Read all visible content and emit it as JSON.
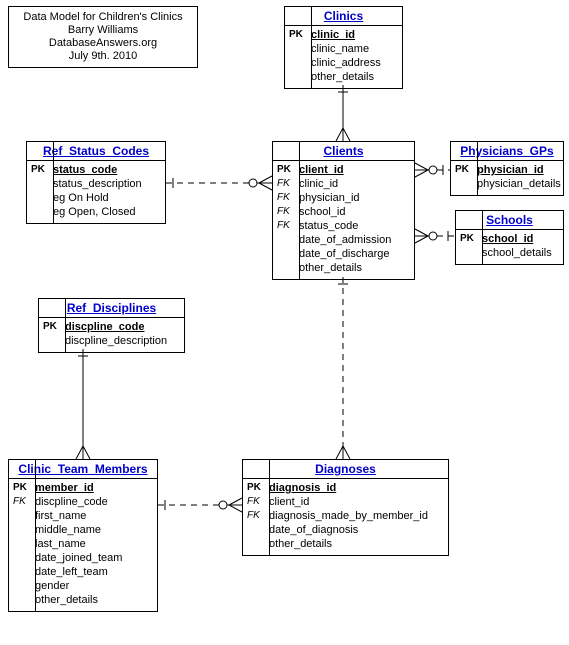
{
  "title": {
    "line1": "Data Model for Children's Clinics",
    "line2": "Barry Williams",
    "line3": "DatabaseAnswers.org",
    "line4": "July 9th. 2010"
  },
  "entities": {
    "clinics": {
      "name": "Clinics",
      "attrs": [
        {
          "key": "PK",
          "col": "clinic_id",
          "pk": true
        },
        {
          "key": "",
          "col": "clinic_name"
        },
        {
          "key": "",
          "col": "clinic_address"
        },
        {
          "key": "",
          "col": "other_details"
        }
      ]
    },
    "clients": {
      "name": "Clients",
      "attrs": [
        {
          "key": "PK",
          "col": "client_id",
          "pk": true
        },
        {
          "key": "FK",
          "col": "clinic_id",
          "fk": true
        },
        {
          "key": "FK",
          "col": "physician_id",
          "fk": true
        },
        {
          "key": "FK",
          "col": "school_id",
          "fk": true
        },
        {
          "key": "FK",
          "col": "status_code",
          "fk": true
        },
        {
          "key": "",
          "col": "date_of_admission"
        },
        {
          "key": "",
          "col": "date_of_discharge"
        },
        {
          "key": "",
          "col": "other_details"
        }
      ]
    },
    "ref_status_codes": {
      "name": "Ref_Status_Codes",
      "attrs": [
        {
          "key": "PK",
          "col": "status_code",
          "pk": true
        },
        {
          "key": "",
          "col": "status_description"
        },
        {
          "key": "",
          "col": "eg On Hold"
        },
        {
          "key": "",
          "col": "eg Open, Closed"
        }
      ]
    },
    "physicians_gps": {
      "name": "Physicians_GPs",
      "attrs": [
        {
          "key": "PK",
          "col": "physician_id",
          "pk": true
        },
        {
          "key": "",
          "col": "physician_details"
        }
      ]
    },
    "schools": {
      "name": "Schools",
      "attrs": [
        {
          "key": "PK",
          "col": "school_id",
          "pk": true
        },
        {
          "key": "",
          "col": "school_details"
        }
      ]
    },
    "ref_disciplines": {
      "name": "Ref_Disciplines",
      "attrs": [
        {
          "key": "PK",
          "col": "discpline_code",
          "pk": true
        },
        {
          "key": "",
          "col": "discpline_description"
        }
      ]
    },
    "clinic_team_members": {
      "name": "Clinic_Team_Members",
      "attrs": [
        {
          "key": "PK",
          "col": "member_id",
          "pk": true
        },
        {
          "key": "FK",
          "col": "discpline_code",
          "fk": true
        },
        {
          "key": "",
          "col": "first_name"
        },
        {
          "key": "",
          "col": "middle_name"
        },
        {
          "key": "",
          "col": "last_name"
        },
        {
          "key": "",
          "col": "date_joined_team"
        },
        {
          "key": "",
          "col": "date_left_team"
        },
        {
          "key": "",
          "col": "gender"
        },
        {
          "key": "",
          "col": "other_details"
        }
      ]
    },
    "diagnoses": {
      "name": "Diagnoses",
      "attrs": [
        {
          "key": "PK",
          "col": "diagnosis_id",
          "pk": true
        },
        {
          "key": "FK",
          "col": "client_id",
          "fk": true
        },
        {
          "key": "FK",
          "col": "diagnosis_made_by_member_id",
          "fk": true
        },
        {
          "key": "",
          "col": "date_of_diagnosis"
        },
        {
          "key": "",
          "col": "other_details"
        }
      ]
    }
  },
  "relationships": [
    {
      "from": "clinics",
      "to": "clients",
      "type": "one-to-many",
      "dashed": false
    },
    {
      "from": "ref_status_codes",
      "to": "clients",
      "type": "one-to-many",
      "dashed": true
    },
    {
      "from": "physicians_gps",
      "to": "clients",
      "type": "one-to-many",
      "dashed": true
    },
    {
      "from": "schools",
      "to": "clients",
      "type": "one-to-many",
      "dashed": true
    },
    {
      "from": "ref_disciplines",
      "to": "clinic_team_members",
      "type": "one-to-many",
      "dashed": false
    },
    {
      "from": "clients",
      "to": "diagnoses",
      "type": "one-to-many",
      "dashed": true
    },
    {
      "from": "clinic_team_members",
      "to": "diagnoses",
      "type": "one-to-many",
      "dashed": true
    }
  ]
}
